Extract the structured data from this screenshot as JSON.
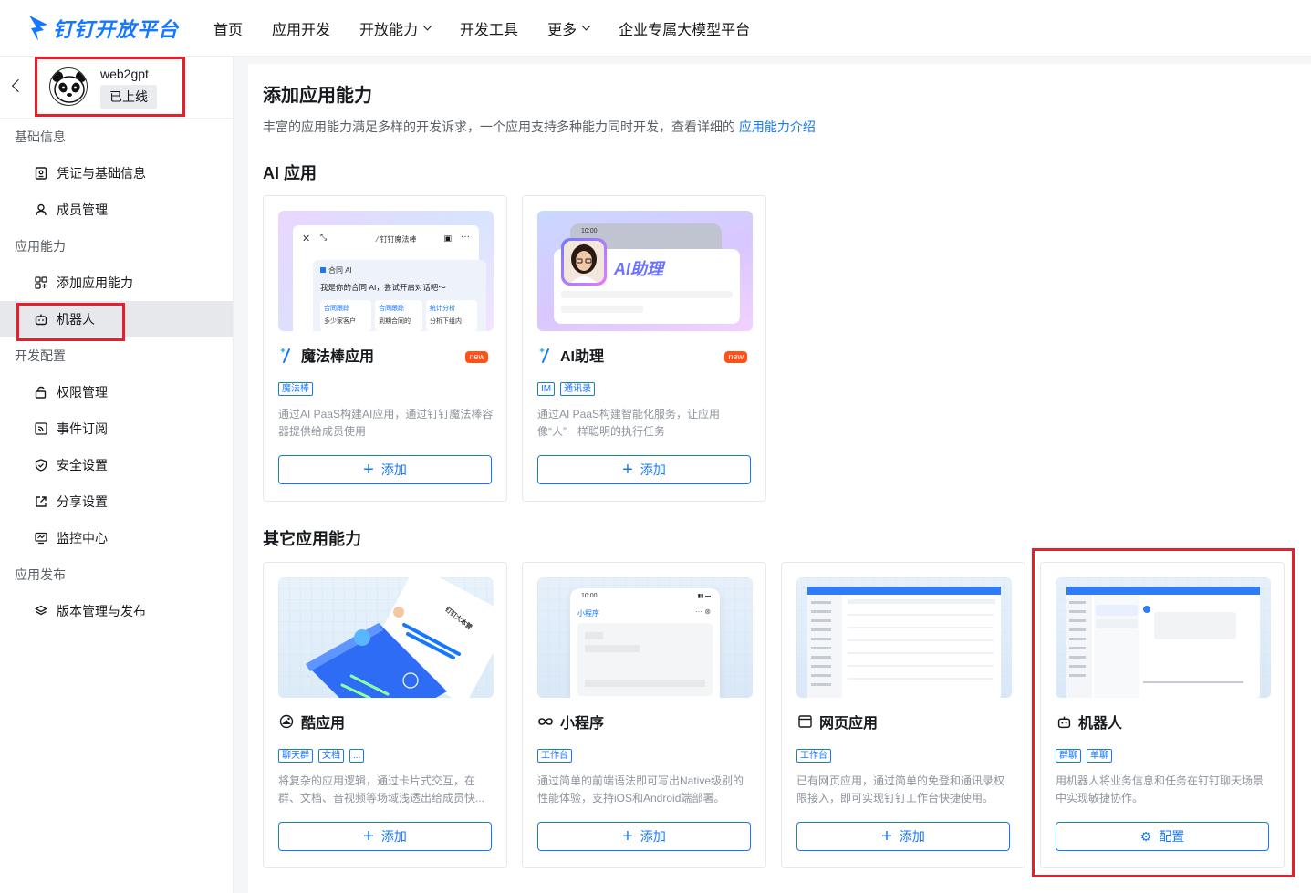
{
  "brand": {
    "name": "钉钉开放平台",
    "color": "#1677ff"
  },
  "topnav": {
    "items": [
      {
        "label": "首页",
        "dropdown": false
      },
      {
        "label": "应用开发",
        "dropdown": false
      },
      {
        "label": "开放能力",
        "dropdown": true
      },
      {
        "label": "开发工具",
        "dropdown": false
      },
      {
        "label": "更多",
        "dropdown": true
      },
      {
        "label": "企业专属大模型平台",
        "dropdown": false
      }
    ]
  },
  "app": {
    "name": "web2gpt",
    "status": "已上线"
  },
  "sidebar": {
    "groups": [
      {
        "label": "基础信息",
        "items": [
          {
            "label": "凭证与基础信息",
            "icon": "credential-icon"
          },
          {
            "label": "成员管理",
            "icon": "member-icon"
          }
        ]
      },
      {
        "label": "应用能力",
        "items": [
          {
            "label": "添加应用能力",
            "icon": "add-capability-icon"
          },
          {
            "label": "机器人",
            "icon": "robot-icon",
            "active": true
          }
        ]
      },
      {
        "label": "开发配置",
        "items": [
          {
            "label": "权限管理",
            "icon": "lock-icon"
          },
          {
            "label": "事件订阅",
            "icon": "rss-icon"
          },
          {
            "label": "安全设置",
            "icon": "shield-icon"
          },
          {
            "label": "分享设置",
            "icon": "share-icon"
          },
          {
            "label": "监控中心",
            "icon": "monitor-icon"
          }
        ]
      },
      {
        "label": "应用发布",
        "items": [
          {
            "label": "版本管理与发布",
            "icon": "layers-icon"
          }
        ]
      }
    ]
  },
  "main": {
    "title": "添加应用能力",
    "desc": "丰富的应用能力满足多样的开发诉求，一个应用支持多种能力同时开发，查看详细的",
    "desc_link": "应用能力介绍",
    "ai_section": "AI 应用",
    "other_section": "其它应用能力",
    "ai_cards": [
      {
        "title": "魔法棒应用",
        "badge": "new",
        "tags": [
          "魔法棒"
        ],
        "desc": "通过AI PaaS构建AI应用，通过钉钉魔法棒容器提供给成员使用",
        "button": "添加"
      },
      {
        "title": "AI助理",
        "badge": "new",
        "tags": [
          "IM",
          "通讯录"
        ],
        "desc": "通过AI PaaS构建智能化服务，让应用像“人”一样聪明的执行任务",
        "button": "添加"
      }
    ],
    "other_cards": [
      {
        "title": "酷应用",
        "tags": [
          "聊天群",
          "文档",
          "..."
        ],
        "desc": "将复杂的应用逻辑，通过卡片式交互，在群、文档、音视频等场域浅透出给成员快...",
        "button": "添加"
      },
      {
        "title": "小程序",
        "tags": [
          "工作台"
        ],
        "desc": "通过简单的前端语法即可写出Native级别的性能体验，支持iOS和Android端部署。",
        "button": "添加"
      },
      {
        "title": "网页应用",
        "tags": [
          "工作台"
        ],
        "desc": "已有网页应用，通过简单的免登和通讯录权限接入，即可实现钉钉工作台快捷使用。",
        "button": "添加"
      },
      {
        "title": "机器人",
        "tags": [
          "群聊",
          "单聊"
        ],
        "desc": "用机器人将业务信息和任务在钉钉聊天场景中实现敏捷协作。",
        "button": "配置"
      }
    ],
    "thumbs": {
      "magic": {
        "header": "钉钉魔法棒",
        "subtitle": "合同 AI",
        "line": "我是你的合同 AI，尝试开启对话吧～",
        "chips": [
          "合同跟踪",
          "合同跟踪",
          "统计分析"
        ],
        "chip_notes": [
          "多少家客户",
          "到期合同的",
          "分析下组内"
        ]
      },
      "assistant": {
        "time": "10:00",
        "label": "AI助理"
      },
      "mini": {
        "time": "10:00",
        "label": "小程序"
      },
      "cool": {
        "label": "钉钉大本营"
      }
    }
  }
}
